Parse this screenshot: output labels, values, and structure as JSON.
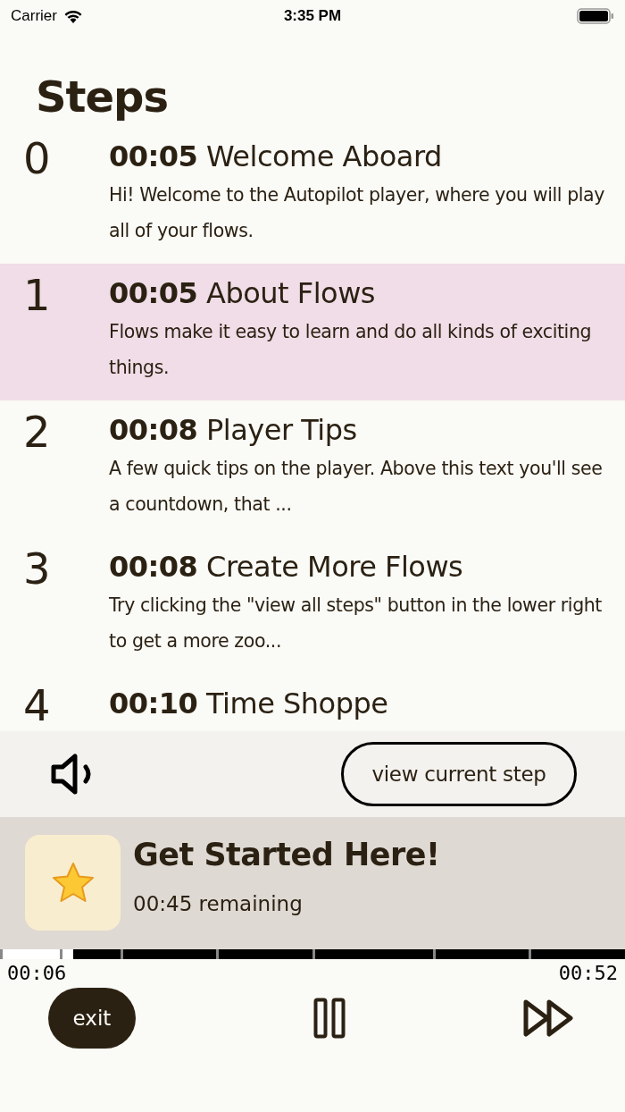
{
  "status_bar": {
    "carrier": "Carrier",
    "time": "3:35 PM"
  },
  "title": "Steps",
  "steps": [
    {
      "number": "0",
      "time": "00:05",
      "title": "Welcome Aboard",
      "description": "Hi! Welcome to the Autopilot player, where you will play all of your flows.",
      "selected": false
    },
    {
      "number": "1",
      "time": "00:05",
      "title": "About Flows",
      "description": "Flows make it easy to learn and do all kinds of exciting things.",
      "selected": true
    },
    {
      "number": "2",
      "time": "00:08",
      "title": "Player Tips",
      "description": "A few quick tips on the player. Above this text you'll see a countdown, that ...",
      "selected": false
    },
    {
      "number": "3",
      "time": "00:08",
      "title": "Create More Flows",
      "description": "Try clicking the \"view all steps\" button in the lower right to get a more zoo...",
      "selected": false
    },
    {
      "number": "4",
      "time": "00:10",
      "title": "Time Shoppe",
      "selected": false
    }
  ],
  "controls": {
    "view_button": "view current step"
  },
  "now_playing": {
    "title": "Get Started Here!",
    "remaining": "00:45 remaining"
  },
  "progress": {
    "level": 0.117,
    "elapsed": "00:06",
    "total": "00:52"
  },
  "buttons": {
    "exit": "exit"
  }
}
